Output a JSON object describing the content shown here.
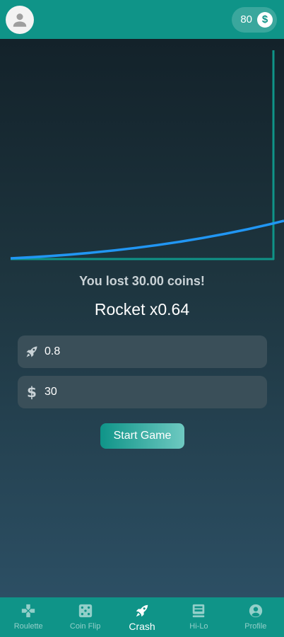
{
  "balance": {
    "amount": "80",
    "currency_icon": "dollar-coin-icon"
  },
  "game": {
    "result_text": "You lost 30.00 coins!",
    "multiplier_text": "Rocket x0.64",
    "curve_color": "#2196f3",
    "axis_color": "#0f9488"
  },
  "inputs": {
    "target_multiplier": {
      "value": "0.8",
      "icon": "rocket-icon"
    },
    "bet_amount": {
      "value": "30",
      "icon": "dollar-icon"
    }
  },
  "start_button": {
    "label": "Start Game"
  },
  "nav": {
    "items": [
      {
        "label": "Roulette",
        "icon": "gamepad-icon",
        "active": false
      },
      {
        "label": "Coin Flip",
        "icon": "dice-icon",
        "active": false
      },
      {
        "label": "Crash",
        "icon": "rocket-icon",
        "active": true
      },
      {
        "label": "Hi-Lo",
        "icon": "cards-icon",
        "active": false
      },
      {
        "label": "Profile",
        "icon": "account-circle-icon",
        "active": false
      }
    ]
  },
  "colors": {
    "primary": "#0f9488",
    "background": "#15252c",
    "field": "#3a4f59"
  }
}
